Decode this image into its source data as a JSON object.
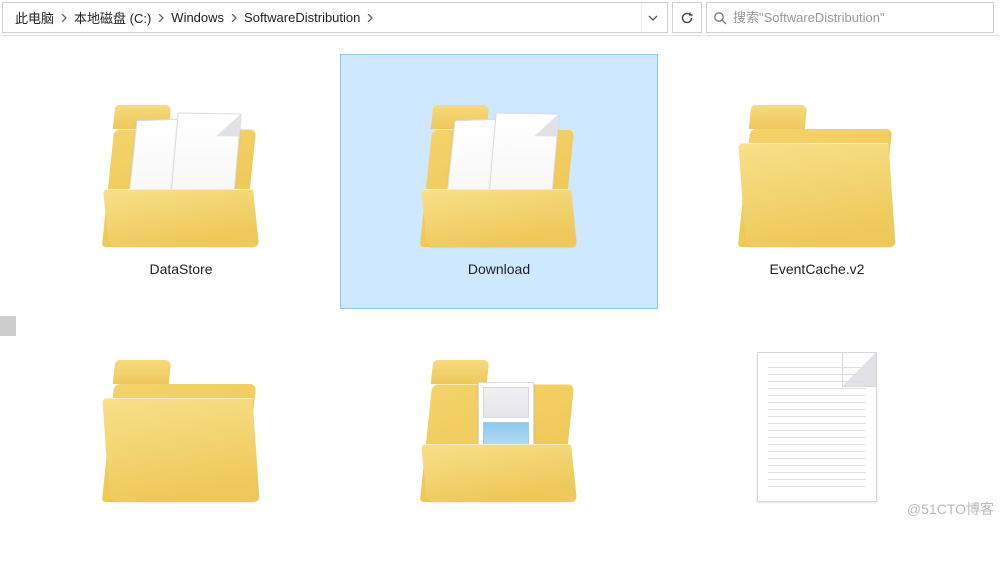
{
  "breadcrumb": {
    "segments": [
      "此电脑",
      "本地磁盘 (C:)",
      "Windows",
      "SoftwareDistribution"
    ]
  },
  "search": {
    "placeholder": "搜索\"SoftwareDistribution\""
  },
  "folders": [
    {
      "label": "DataStore",
      "kind": "folder-open",
      "selected": false
    },
    {
      "label": "Download",
      "kind": "folder-open",
      "selected": true
    },
    {
      "label": "EventCache.v2",
      "kind": "folder-closed",
      "selected": false
    },
    {
      "label": "",
      "kind": "folder-closed",
      "selected": false
    },
    {
      "label": "",
      "kind": "folder-pic",
      "selected": false
    },
    {
      "label": "",
      "kind": "textdoc",
      "selected": false
    }
  ],
  "watermark": "@51CTO博客"
}
